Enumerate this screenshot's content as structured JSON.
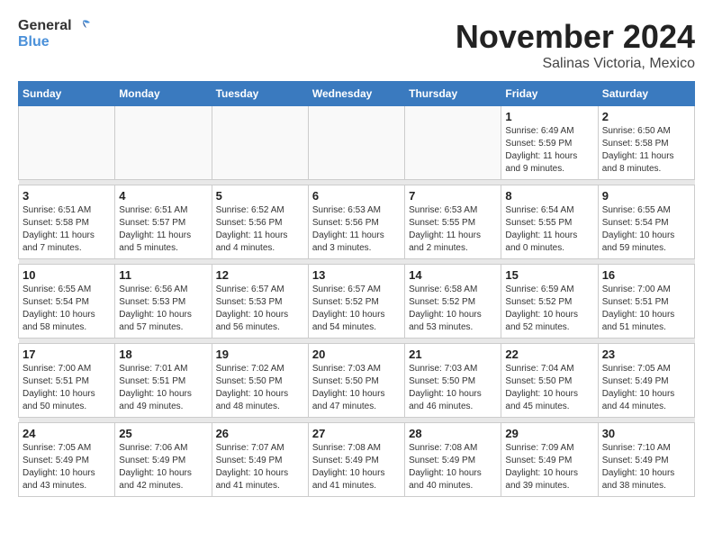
{
  "header": {
    "logo_general": "General",
    "logo_blue": "Blue",
    "month": "November 2024",
    "location": "Salinas Victoria, Mexico"
  },
  "weekdays": [
    "Sunday",
    "Monday",
    "Tuesday",
    "Wednesday",
    "Thursday",
    "Friday",
    "Saturday"
  ],
  "weeks": [
    [
      {
        "day": "",
        "info": ""
      },
      {
        "day": "",
        "info": ""
      },
      {
        "day": "",
        "info": ""
      },
      {
        "day": "",
        "info": ""
      },
      {
        "day": "",
        "info": ""
      },
      {
        "day": "1",
        "info": "Sunrise: 6:49 AM\nSunset: 5:59 PM\nDaylight: 11 hours and 9 minutes."
      },
      {
        "day": "2",
        "info": "Sunrise: 6:50 AM\nSunset: 5:58 PM\nDaylight: 11 hours and 8 minutes."
      }
    ],
    [
      {
        "day": "3",
        "info": "Sunrise: 6:51 AM\nSunset: 5:58 PM\nDaylight: 11 hours and 7 minutes."
      },
      {
        "day": "4",
        "info": "Sunrise: 6:51 AM\nSunset: 5:57 PM\nDaylight: 11 hours and 5 minutes."
      },
      {
        "day": "5",
        "info": "Sunrise: 6:52 AM\nSunset: 5:56 PM\nDaylight: 11 hours and 4 minutes."
      },
      {
        "day": "6",
        "info": "Sunrise: 6:53 AM\nSunset: 5:56 PM\nDaylight: 11 hours and 3 minutes."
      },
      {
        "day": "7",
        "info": "Sunrise: 6:53 AM\nSunset: 5:55 PM\nDaylight: 11 hours and 2 minutes."
      },
      {
        "day": "8",
        "info": "Sunrise: 6:54 AM\nSunset: 5:55 PM\nDaylight: 11 hours and 0 minutes."
      },
      {
        "day": "9",
        "info": "Sunrise: 6:55 AM\nSunset: 5:54 PM\nDaylight: 10 hours and 59 minutes."
      }
    ],
    [
      {
        "day": "10",
        "info": "Sunrise: 6:55 AM\nSunset: 5:54 PM\nDaylight: 10 hours and 58 minutes."
      },
      {
        "day": "11",
        "info": "Sunrise: 6:56 AM\nSunset: 5:53 PM\nDaylight: 10 hours and 57 minutes."
      },
      {
        "day": "12",
        "info": "Sunrise: 6:57 AM\nSunset: 5:53 PM\nDaylight: 10 hours and 56 minutes."
      },
      {
        "day": "13",
        "info": "Sunrise: 6:57 AM\nSunset: 5:52 PM\nDaylight: 10 hours and 54 minutes."
      },
      {
        "day": "14",
        "info": "Sunrise: 6:58 AM\nSunset: 5:52 PM\nDaylight: 10 hours and 53 minutes."
      },
      {
        "day": "15",
        "info": "Sunrise: 6:59 AM\nSunset: 5:52 PM\nDaylight: 10 hours and 52 minutes."
      },
      {
        "day": "16",
        "info": "Sunrise: 7:00 AM\nSunset: 5:51 PM\nDaylight: 10 hours and 51 minutes."
      }
    ],
    [
      {
        "day": "17",
        "info": "Sunrise: 7:00 AM\nSunset: 5:51 PM\nDaylight: 10 hours and 50 minutes."
      },
      {
        "day": "18",
        "info": "Sunrise: 7:01 AM\nSunset: 5:51 PM\nDaylight: 10 hours and 49 minutes."
      },
      {
        "day": "19",
        "info": "Sunrise: 7:02 AM\nSunset: 5:50 PM\nDaylight: 10 hours and 48 minutes."
      },
      {
        "day": "20",
        "info": "Sunrise: 7:03 AM\nSunset: 5:50 PM\nDaylight: 10 hours and 47 minutes."
      },
      {
        "day": "21",
        "info": "Sunrise: 7:03 AM\nSunset: 5:50 PM\nDaylight: 10 hours and 46 minutes."
      },
      {
        "day": "22",
        "info": "Sunrise: 7:04 AM\nSunset: 5:50 PM\nDaylight: 10 hours and 45 minutes."
      },
      {
        "day": "23",
        "info": "Sunrise: 7:05 AM\nSunset: 5:49 PM\nDaylight: 10 hours and 44 minutes."
      }
    ],
    [
      {
        "day": "24",
        "info": "Sunrise: 7:05 AM\nSunset: 5:49 PM\nDaylight: 10 hours and 43 minutes."
      },
      {
        "day": "25",
        "info": "Sunrise: 7:06 AM\nSunset: 5:49 PM\nDaylight: 10 hours and 42 minutes."
      },
      {
        "day": "26",
        "info": "Sunrise: 7:07 AM\nSunset: 5:49 PM\nDaylight: 10 hours and 41 minutes."
      },
      {
        "day": "27",
        "info": "Sunrise: 7:08 AM\nSunset: 5:49 PM\nDaylight: 10 hours and 41 minutes."
      },
      {
        "day": "28",
        "info": "Sunrise: 7:08 AM\nSunset: 5:49 PM\nDaylight: 10 hours and 40 minutes."
      },
      {
        "day": "29",
        "info": "Sunrise: 7:09 AM\nSunset: 5:49 PM\nDaylight: 10 hours and 39 minutes."
      },
      {
        "day": "30",
        "info": "Sunrise: 7:10 AM\nSunset: 5:49 PM\nDaylight: 10 hours and 38 minutes."
      }
    ]
  ]
}
